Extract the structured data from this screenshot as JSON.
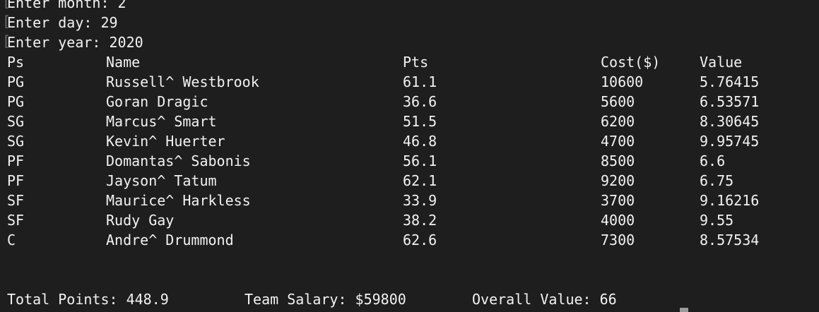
{
  "prompts": [
    {
      "label": "Enter month: 2"
    },
    {
      "label": "Enter day: 29"
    },
    {
      "label": "Enter year: 2020"
    }
  ],
  "table": {
    "headers": {
      "ps": "Ps",
      "name": "Name",
      "pts": "Pts",
      "cost": "Cost($)",
      "value": "Value"
    },
    "rows": [
      {
        "ps": "PG",
        "name": "Russell^ Westbrook",
        "pts": "61.1",
        "cost": "10600",
        "value": "5.76415"
      },
      {
        "ps": "PG",
        "name": "Goran Dragic",
        "pts": "36.6",
        "cost": "5600",
        "value": "6.53571"
      },
      {
        "ps": "SG",
        "name": "Marcus^ Smart",
        "pts": "51.5",
        "cost": "6200",
        "value": "8.30645"
      },
      {
        "ps": "SG",
        "name": "Kevin^ Huerter",
        "pts": "46.8",
        "cost": "4700",
        "value": "9.95745"
      },
      {
        "ps": "PF",
        "name": "Domantas^ Sabonis",
        "pts": "56.1",
        "cost": "8500",
        "value": "6.6"
      },
      {
        "ps": "PF",
        "name": "Jayson^ Tatum",
        "pts": "62.1",
        "cost": "9200",
        "value": "6.75"
      },
      {
        "ps": "SF",
        "name": "Maurice^ Harkless",
        "pts": "33.9",
        "cost": "3700",
        "value": "9.16216"
      },
      {
        "ps": "SF",
        "name": "Rudy Gay",
        "pts": "38.2",
        "cost": "4000",
        "value": "9.55"
      },
      {
        "ps": "C",
        "name": "Andre^ Drummond",
        "pts": "62.6",
        "cost": "7300",
        "value": "8.57534"
      }
    ]
  },
  "summary": {
    "total_points": "Total Points: 448.9",
    "team_salary": "Team Salary: $59800",
    "overall_value": "Overall Value: 66"
  },
  "colors": {
    "background": "#1e1e1e",
    "text": "#f2f2f2",
    "bracket": "#6a6a6a"
  }
}
